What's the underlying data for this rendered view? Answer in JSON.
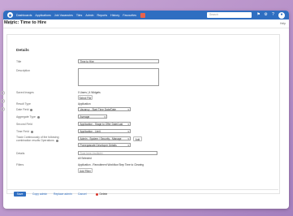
{
  "colors": {
    "accent": "#2f6ec1",
    "danger": "#d9342b",
    "badge": "#e8634b"
  },
  "nav": {
    "items": [
      "Dashboards",
      "Applications",
      "Job Vacancies",
      "Tiles",
      "Admin",
      "Reports",
      "History",
      "Favourites"
    ]
  },
  "search": {
    "placeholder": "Search"
  },
  "subbar": {
    "back": "< J&",
    "help": "Help"
  },
  "page": {
    "title": "Metric: Time to Hire"
  },
  "section": {
    "title": "Details"
  },
  "fields": {
    "title": {
      "label": "Title",
      "value": "Time to Hire"
    },
    "description": {
      "label": "Description"
    },
    "saved_images": {
      "label": "Saved Images",
      "count": "0 Users | 4 Widgets",
      "button": "Select File"
    },
    "result_type": {
      "label": "Result Type",
      "value": "Application"
    },
    "date_field": {
      "label": "Date Field",
      "value": "Vacancy - Start Time Date/Date"
    },
    "aggregate_type": {
      "label": "Aggregate Type",
      "value": "Average"
    },
    "second_field": {
      "label": "Second Field",
      "value": "Application - Stage to Offer Date/Last"
    },
    "time_field": {
      "label": "Time Field",
      "value": "Application - Limit"
    },
    "tracks": {
      "label": "Track Continuously of the following combination results Operations",
      "value1": "Admin - System / Security - Manage",
      "add": "Add",
      "value2": "Pomegranate Developer Details"
    },
    "details": {
      "label": "Details",
      "placeholder": "Type here (multiple)",
      "note": "All Selected"
    },
    "filters": {
      "label": "Filters",
      "value": "Application - Recruitment Workflow Step Time to Clearing",
      "button": "Add Filter"
    }
  },
  "footer": {
    "save": "Save",
    "copy": "Copy admin",
    "replace": "Replace admin",
    "cancel": "Cancel",
    "delete": "Delete"
  }
}
